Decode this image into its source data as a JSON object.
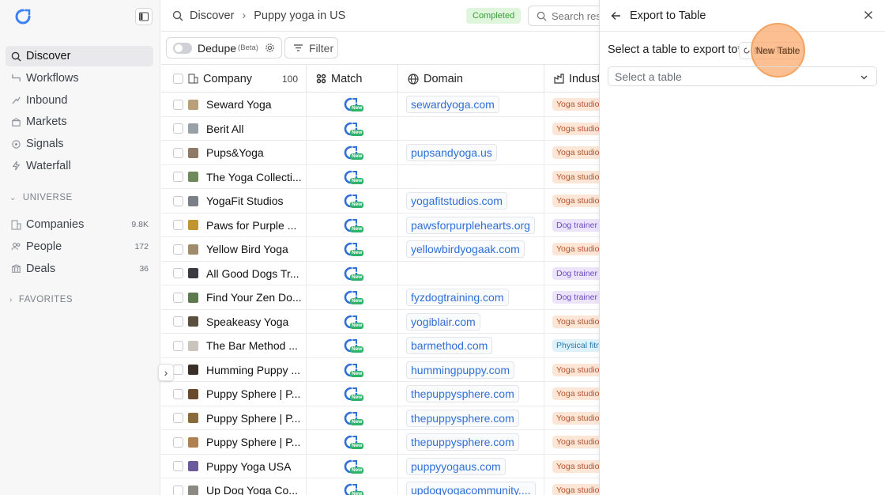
{
  "sidebar": {
    "nav": [
      {
        "label": "Discover",
        "icon": "search-icon",
        "active": true
      },
      {
        "label": "Workflows",
        "icon": "workflow-icon"
      },
      {
        "label": "Inbound",
        "icon": "inbound-icon"
      },
      {
        "label": "Markets",
        "icon": "markets-icon"
      },
      {
        "label": "Signals",
        "icon": "signals-icon"
      },
      {
        "label": "Waterfall",
        "icon": "waterfall-icon"
      }
    ],
    "universe_label": "UNIVERSE",
    "universe_items": [
      {
        "label": "Companies",
        "count": "9.8K",
        "icon": "building-icon"
      },
      {
        "label": "People",
        "count": "172",
        "icon": "people-icon"
      },
      {
        "label": "Deals",
        "count": "36",
        "icon": "deals-icon"
      }
    ],
    "favorites_label": "FAVORITES"
  },
  "header": {
    "crumb_root": "Discover",
    "crumb_current": "Puppy yoga in US",
    "status": "Completed",
    "search_placeholder": "Search results"
  },
  "toolbar": {
    "dedupe_label": "Dedupe",
    "beta_label": "(Beta)",
    "filter_label": "Filter"
  },
  "table": {
    "columns": {
      "company": "Company",
      "company_count": "100",
      "match": "Match",
      "domain": "Domain",
      "industry": "Industry"
    },
    "new_badge": "New",
    "rows": [
      {
        "company": "Seward Yoga",
        "domain": "sewardyoga.com",
        "industry": "Yoga studio",
        "fav": "#b9a07a"
      },
      {
        "company": "Berit All",
        "domain": "",
        "industry": "Yoga studio",
        "fav": "#9aa0a8"
      },
      {
        "company": "Pups&Yoga",
        "domain": "pupsandyoga.us",
        "industry": "Yoga studio",
        "fav": "#8e7a66"
      },
      {
        "company": "The Yoga Collecti...",
        "domain": "",
        "industry": "Yoga studio",
        "fav": "#6f8a5a"
      },
      {
        "company": "YogaFit Studios",
        "domain": "yogafitstudios.com",
        "industry": "Yoga studio",
        "fav": "#7a7f88"
      },
      {
        "company": "Paws for Purple ...",
        "domain": "pawsforpurplehearts.org",
        "industry": "Dog trainer",
        "fav": "#c0962f"
      },
      {
        "company": "Yellow Bird Yoga",
        "domain": "yellowbirdyogaak.com",
        "industry": "Yoga studio",
        "fav": "#a08c6a"
      },
      {
        "company": "All Good Dogs Tr...",
        "domain": "",
        "industry": "Dog trainer",
        "fav": "#3a3a40"
      },
      {
        "company": "Find Your Zen Do...",
        "domain": "fyzdogtraining.com",
        "industry": "Dog trainer",
        "fav": "#5d7a4e"
      },
      {
        "company": "Speakeasy Yoga",
        "domain": "yogiblair.com",
        "industry": "Yoga studio",
        "fav": "#5a5040"
      },
      {
        "company": "The Bar Method ...",
        "domain": "barmethod.com",
        "industry": "Physical fitness",
        "fav": "#c9c4bc"
      },
      {
        "company": "Humming Puppy ...",
        "domain": "hummingpuppy.com",
        "industry": "Yoga studio",
        "fav": "#3a3028"
      },
      {
        "company": "Puppy Sphere | P...",
        "domain": "thepuppysphere.com",
        "industry": "Yoga studio",
        "fav": "#6a4a2a"
      },
      {
        "company": "Puppy Sphere | P...",
        "domain": "thepuppysphere.com",
        "industry": "Yoga studio",
        "fav": "#8a6a3a"
      },
      {
        "company": "Puppy Sphere | P...",
        "domain": "thepuppysphere.com",
        "industry": "Yoga studio",
        "fav": "#b08050"
      },
      {
        "company": "Puppy Yoga USA",
        "domain": "puppyyogaus.com",
        "industry": "Yoga studio",
        "fav": "#6a5a9a"
      },
      {
        "company": "Up Dog Yoga Co...",
        "domain": "updogyogacommunity....",
        "industry": "Yoga studio",
        "fav": "#8a8a82"
      }
    ]
  },
  "panel": {
    "title": "Export to Table",
    "export_label": "Select a table to export to*",
    "new_table_label": "New Table",
    "select_placeholder": "Select a table"
  },
  "colors": {
    "yoga_tag_bg": "#fde6d6",
    "yoga_tag_fg": "#b4532a",
    "dog_tag_bg": "#ece4fb",
    "dog_tag_fg": "#6b4cbf",
    "fitness_tag_bg": "#dff1fb",
    "fitness_tag_fg": "#2a7aa8",
    "accent": "#2f6fd6"
  }
}
